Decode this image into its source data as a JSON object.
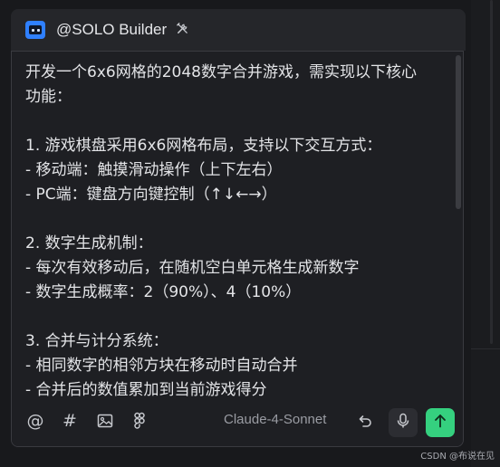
{
  "header": {
    "title": "@SOLO Builder",
    "agent_icon": "agent-screen-icon",
    "tools_icon": "tools-icon"
  },
  "content": {
    "lines": [
      "开发一个6x6网格的2048数字合并游戏，需实现以下核心",
      "功能：",
      "",
      "1. 游戏棋盘采用6x6网格布局，支持以下交互方式：",
      "   - 移动端：触摸滑动操作（上下左右）",
      "   - PC端：键盘方向键控制（↑↓←→）",
      "",
      "2. 数字生成机制：",
      "   - 每次有效移动后，在随机空白单元格生成新数字",
      "   - 数字生成概率：2（90%）、4（10%）",
      "",
      "3. 合并与计分系统：",
      "   - 相同数字的相邻方块在移动时自动合并",
      "   - 合并后的数值累加到当前游戏得分"
    ]
  },
  "toolbar": {
    "mention_symbol": "@",
    "hash_symbol": "#",
    "model": "Claude-4-Sonnet"
  },
  "watermark": "CSDN @布说在见",
  "colors": {
    "send_button": "#35d07f",
    "agent_icon": "#2f80ff",
    "background": "#1e1f23"
  }
}
